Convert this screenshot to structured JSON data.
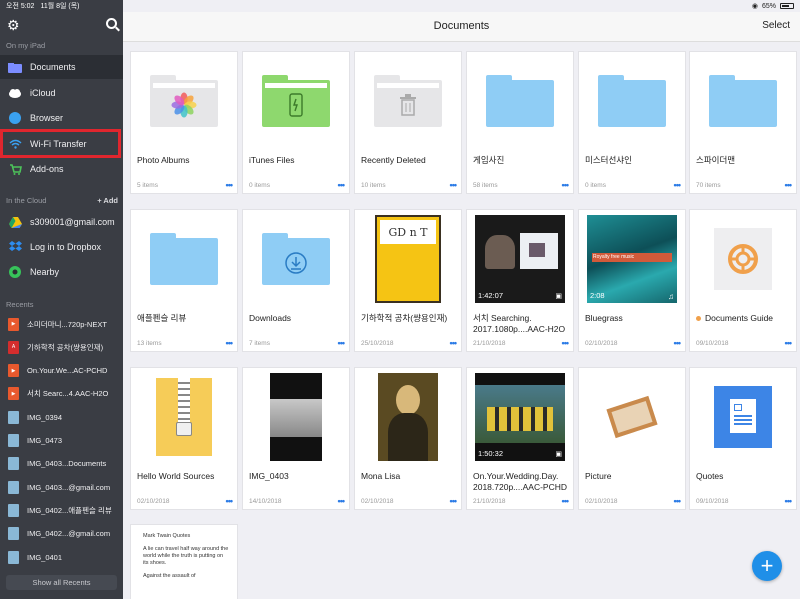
{
  "status_bar": {
    "time": "오전 5:02",
    "date": "11월 8일 (목)",
    "battery": "65%"
  },
  "sidebar": {
    "on_my_ipad_heading": "On my iPad",
    "items": [
      {
        "label": "Documents",
        "icon": "folder-icon",
        "active": true
      },
      {
        "label": "iCloud",
        "icon": "cloud-icon"
      },
      {
        "label": "Browser",
        "icon": "compass-icon"
      },
      {
        "label": "Wi-Fi Transfer",
        "icon": "wifi-icon",
        "highlighted": true
      },
      {
        "label": "Add-ons",
        "icon": "cart-icon"
      }
    ],
    "in_the_cloud_heading": "In the Cloud",
    "add_label": "+ Add",
    "cloud_items": [
      {
        "label": "s309001@gmail.com",
        "icon": "google-drive-icon"
      },
      {
        "label": "Log in to Dropbox",
        "icon": "dropbox-icon"
      },
      {
        "label": "Nearby",
        "icon": "nearby-icon"
      }
    ],
    "recents_heading": "Recents",
    "recents": [
      {
        "label": "소미더마니...720p-NEXT",
        "type": "video"
      },
      {
        "label": "기하학적 공차(썅용인재)",
        "type": "pdf"
      },
      {
        "label": "On.Your.We...AC-PCHD",
        "type": "video"
      },
      {
        "label": "서치 Searc...4.AAC-H2O",
        "type": "video"
      },
      {
        "label": "IMG_0394",
        "type": "image"
      },
      {
        "label": "IMG_0473",
        "type": "image"
      },
      {
        "label": "IMG_0403...Documents",
        "type": "image"
      },
      {
        "label": "IMG_0403...@gmail.com",
        "type": "image"
      },
      {
        "label": "IMG_0402...애플펜슬 리뷰",
        "type": "image"
      },
      {
        "label": "IMG_0402...@gmail.com",
        "type": "image"
      },
      {
        "label": "IMG_0401",
        "type": "image"
      }
    ],
    "show_all_label": "Show all Recents"
  },
  "header": {
    "title": "Documents",
    "select_label": "Select"
  },
  "grid": [
    {
      "name": "Photo Albums",
      "meta": "5 items",
      "kind": "folder-photos"
    },
    {
      "name": "iTunes Files",
      "meta": "0 items",
      "kind": "folder-itunes"
    },
    {
      "name": "Recently Deleted",
      "meta": "10 items",
      "kind": "folder-trash"
    },
    {
      "name": "게임사진",
      "meta": "58 items",
      "kind": "folder"
    },
    {
      "name": "미스터선샤인",
      "meta": "0 items",
      "kind": "folder"
    },
    {
      "name": "스파이더맨",
      "meta": "70 items",
      "kind": "folder"
    },
    {
      "name": "애플펜슬 리뷰",
      "meta": "13 items",
      "kind": "folder"
    },
    {
      "name": "Downloads",
      "meta": "7 items",
      "kind": "folder-downloads"
    },
    {
      "name": "기하학적 공차(썅용인재)",
      "meta": "25/10/2018",
      "kind": "pdf-thumb",
      "thumb_text": "GD n T"
    },
    {
      "name": "서치 Searching.\n2017.1080p....AAC-H2O",
      "meta": "21/10/2018",
      "kind": "video",
      "duration": "1:42:07"
    },
    {
      "name": "Bluegrass",
      "meta": "02/10/2018",
      "kind": "audio",
      "duration": "2:08",
      "thumb_text": "Royalty free music"
    },
    {
      "name": "Documents Guide",
      "meta": "09/10/2018",
      "kind": "guide"
    },
    {
      "name": "Hello World Sources",
      "meta": "02/10/2018",
      "kind": "zip"
    },
    {
      "name": "IMG_0403",
      "meta": "14/10/2018",
      "kind": "photo-dark"
    },
    {
      "name": "Mona Lisa",
      "meta": "02/10/2018",
      "kind": "mona"
    },
    {
      "name": "On.Your.Wedding.Day.\n2018.720p....AAC-PCHD",
      "meta": "21/10/2018",
      "kind": "video2",
      "duration": "1:50:32"
    },
    {
      "name": "Picture",
      "meta": "02/10/2018",
      "kind": "picture"
    },
    {
      "name": "Quotes",
      "meta": "09/10/2018",
      "kind": "doc"
    },
    {
      "name": "",
      "meta": "",
      "kind": "text-doc",
      "thumb_title": "Mark Twain Quotes",
      "thumb_body": "A lie can travel half way around the world while the truth is putting on its shoes.",
      "thumb_body2": "Against the assault of"
    }
  ],
  "colors": {
    "sidebar_bg": "#3a3d44",
    "folder_blue": "#8fcdf5",
    "folder_green": "#8ed86e",
    "folder_grey": "#e6e6e8",
    "accent_blue": "#1f8fe8",
    "highlight_red": "#e0262e"
  }
}
